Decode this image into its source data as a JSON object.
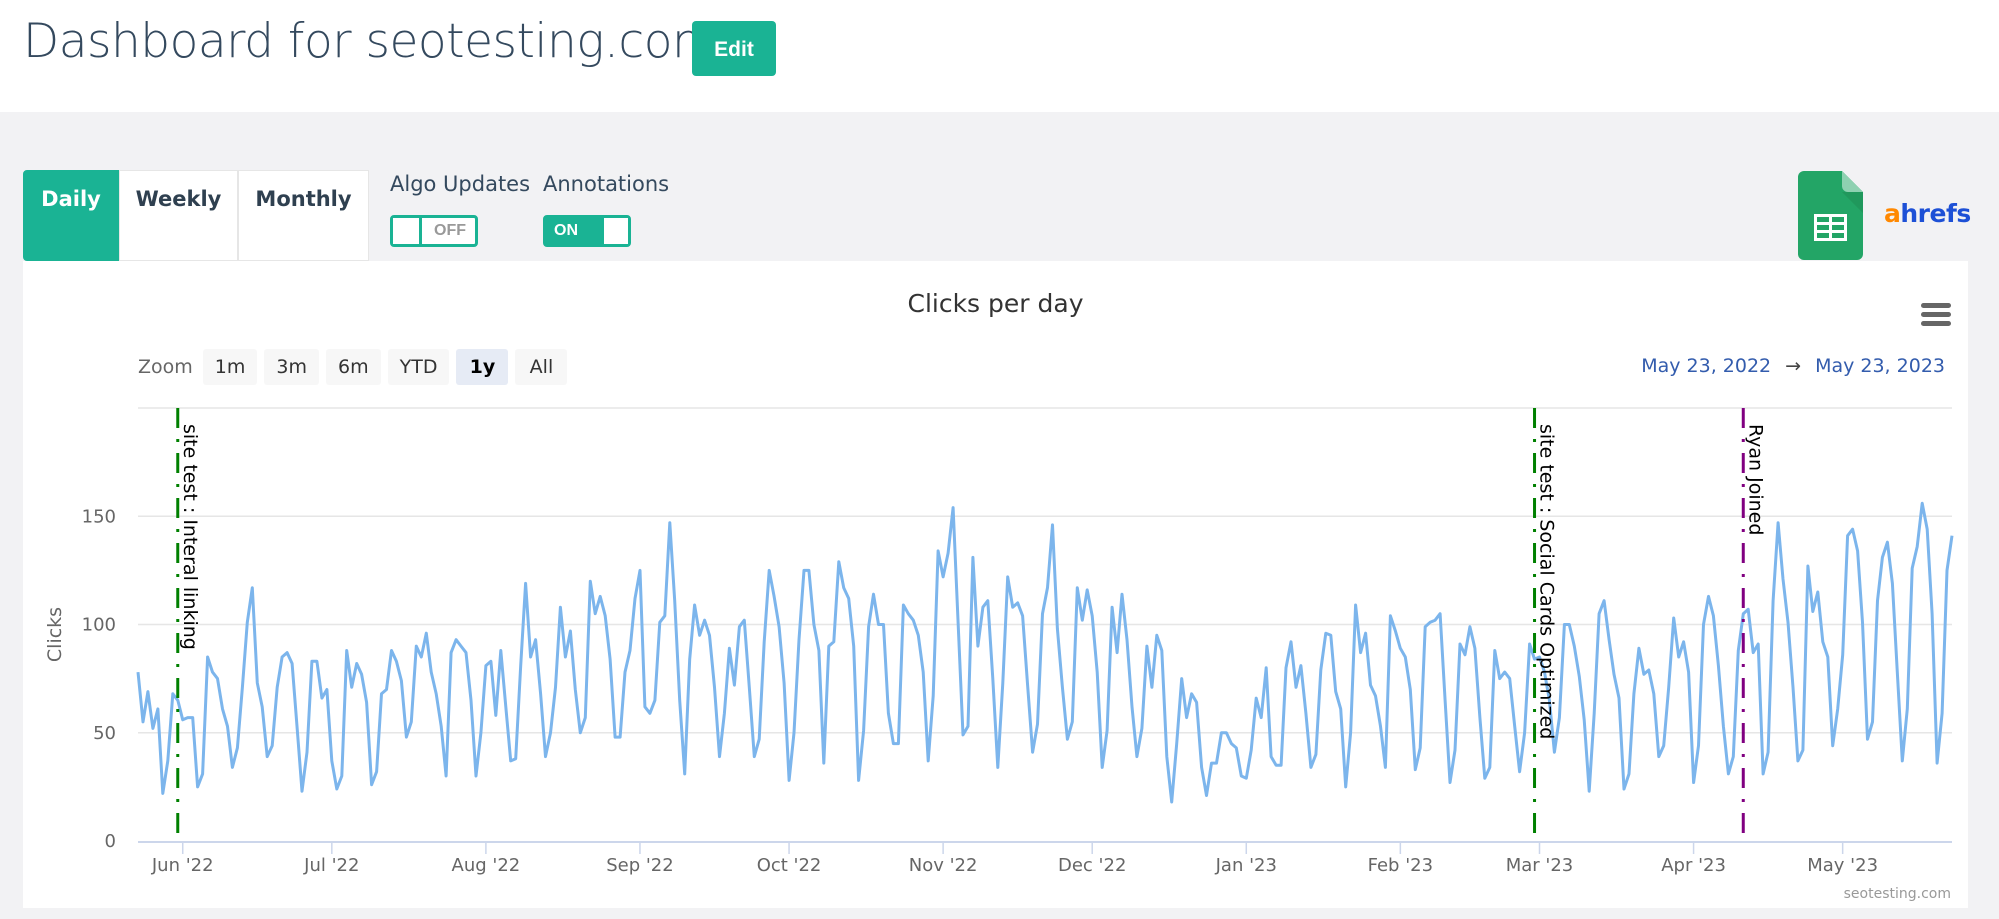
{
  "header": {
    "title": "Dashboard for seotesting.com",
    "edit_label": "Edit"
  },
  "period_tabs": [
    {
      "label": "Daily",
      "active": true
    },
    {
      "label": "Weekly",
      "active": false
    },
    {
      "label": "Monthly",
      "active": false
    }
  ],
  "toggles": {
    "algo_updates": {
      "label": "Algo Updates",
      "state": "OFF"
    },
    "annotations": {
      "label": "Annotations",
      "state": "ON"
    }
  },
  "integrations": {
    "sheets_icon": "google-sheets-icon",
    "ahrefs": {
      "a": "a",
      "rest": "hrefs"
    }
  },
  "colors": {
    "accent": "#1ab394",
    "line": "#7cb5ec",
    "annotation_green": "#008000",
    "annotation_purple": "#800080",
    "date_link": "#335cad"
  },
  "zoom": {
    "label": "Zoom",
    "buttons": [
      {
        "label": "1m",
        "active": false
      },
      {
        "label": "3m",
        "active": false
      },
      {
        "label": "6m",
        "active": false
      },
      {
        "label": "YTD",
        "active": false
      },
      {
        "label": "1y",
        "active": true
      },
      {
        "label": "All",
        "active": false
      }
    ]
  },
  "date_range": {
    "from": "May 23, 2022",
    "arrow": "→",
    "to": "May 23, 2023"
  },
  "credit": "seotesting.com",
  "chart_data": {
    "type": "line",
    "title": "Clicks per day",
    "xlabel": "",
    "ylabel": "Clicks",
    "x_start": "2022-05-23",
    "x_end": "2023-05-23",
    "ylim": [
      0,
      200
    ],
    "yticks": [
      0,
      50,
      100,
      150
    ],
    "xticks": [
      {
        "label": "Jun '22",
        "date": "2022-06-01"
      },
      {
        "label": "Jul '22",
        "date": "2022-07-01"
      },
      {
        "label": "Aug '22",
        "date": "2022-08-01"
      },
      {
        "label": "Sep '22",
        "date": "2022-09-01"
      },
      {
        "label": "Oct '22",
        "date": "2022-10-01"
      },
      {
        "label": "Nov '22",
        "date": "2022-11-01"
      },
      {
        "label": "Dec '22",
        "date": "2022-12-01"
      },
      {
        "label": "Jan '23",
        "date": "2023-01-01"
      },
      {
        "label": "Feb '23",
        "date": "2023-02-01"
      },
      {
        "label": "Mar '23",
        "date": "2023-03-01"
      },
      {
        "label": "Apr '23",
        "date": "2023-04-01"
      },
      {
        "label": "May '23",
        "date": "2023-05-01"
      }
    ],
    "grid": true,
    "legend": "none",
    "series": [
      {
        "name": "Clicks",
        "values": [
          78,
          55,
          69,
          52,
          61,
          22,
          37,
          68,
          65,
          56,
          57,
          57,
          25,
          31,
          85,
          78,
          75,
          61,
          53,
          34,
          43,
          71,
          101,
          117,
          73,
          62,
          39,
          44,
          71,
          85,
          87,
          82,
          53,
          23,
          41,
          83,
          83,
          66,
          70,
          37,
          24,
          30,
          88,
          71,
          82,
          77,
          64,
          26,
          32,
          68,
          70,
          88,
          83,
          74,
          48,
          55,
          90,
          85,
          96,
          78,
          68,
          53,
          30,
          87,
          93,
          90,
          87,
          65,
          30,
          50,
          81,
          83,
          58,
          88,
          62,
          37,
          38,
          81,
          119,
          85,
          93,
          68,
          39,
          50,
          71,
          108,
          85,
          97,
          70,
          50,
          57,
          120,
          105,
          113,
          104,
          84,
          48,
          48,
          78,
          88,
          112,
          125,
          62,
          59,
          65,
          101,
          104,
          147,
          111,
          65,
          31,
          84,
          109,
          95,
          102,
          95,
          71,
          39,
          59,
          89,
          72,
          99,
          102,
          71,
          39,
          47,
          92,
          125,
          113,
          99,
          73,
          28,
          50,
          93,
          125,
          125,
          100,
          88,
          36,
          90,
          92,
          129,
          117,
          112,
          90,
          28,
          51,
          99,
          114,
          100,
          100,
          59,
          45,
          45,
          109,
          105,
          102,
          95,
          78,
          37,
          67,
          134,
          122,
          133,
          154,
          102,
          49,
          53,
          131,
          90,
          108,
          111,
          75,
          34,
          73,
          122,
          108,
          110,
          104,
          72,
          41,
          54,
          105,
          117,
          146,
          98,
          71,
          47,
          55,
          117,
          102,
          116,
          104,
          78,
          34,
          51,
          108,
          87,
          114,
          93,
          62,
          39,
          52,
          90,
          71,
          95,
          88,
          39,
          18,
          45,
          75,
          57,
          68,
          64,
          34,
          21,
          36,
          36,
          50,
          50,
          45,
          43,
          30,
          29,
          42,
          66,
          57,
          80,
          39,
          35,
          35,
          80,
          92,
          71,
          81,
          59,
          34,
          40,
          79,
          96,
          95,
          69,
          61,
          25,
          50,
          109,
          87,
          96,
          72,
          67,
          53,
          34,
          104,
          97,
          89,
          85,
          70,
          33,
          43,
          99,
          101,
          102,
          105,
          65,
          27,
          42,
          91,
          86,
          99,
          89,
          57,
          29,
          34,
          88,
          75,
          78,
          75,
          53,
          32,
          50,
          91,
          84,
          85,
          78,
          65,
          41,
          57,
          100,
          100,
          90,
          76,
          56,
          23,
          59,
          105,
          111,
          93,
          77,
          66,
          24,
          31,
          68,
          89,
          77,
          79,
          68,
          39,
          44,
          71,
          103,
          85,
          92,
          78,
          27,
          44,
          100,
          113,
          104,
          81,
          53,
          31,
          39,
          88,
          105,
          107,
          87,
          91,
          31,
          41,
          111,
          147,
          121,
          101,
          71,
          37,
          42,
          127,
          106,
          115,
          92,
          85,
          44,
          61,
          86,
          141,
          144,
          134,
          101,
          47,
          55,
          111,
          131,
          138,
          119,
          78,
          37,
          61,
          126,
          136,
          156,
          144,
          105,
          36,
          59,
          125,
          141
        ]
      }
    ],
    "annotations": [
      {
        "label": "site test : Interal linking",
        "date": "2022-05-31",
        "color": "#008000"
      },
      {
        "label": "site test : Social Cards Optimized",
        "date": "2023-02-28",
        "color": "#008000"
      },
      {
        "label": "Ryan Joined",
        "date": "2023-04-11",
        "color": "#800080"
      }
    ]
  }
}
